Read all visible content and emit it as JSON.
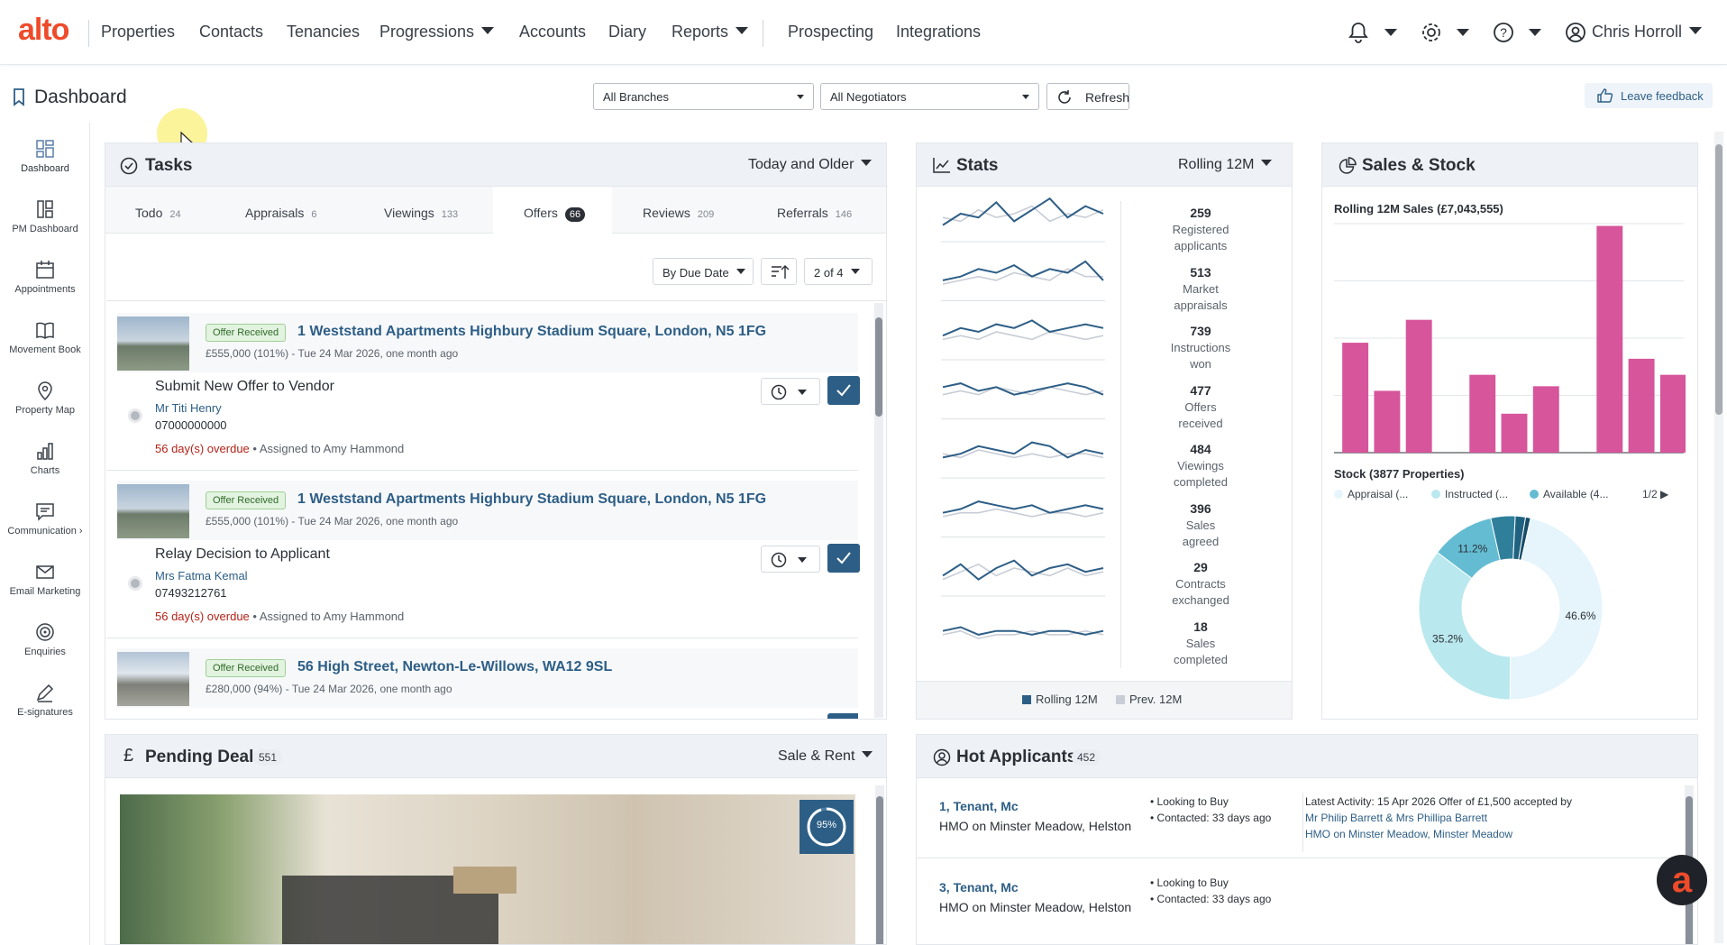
{
  "app": {
    "logo": "alto"
  },
  "nav": {
    "items": [
      "Properties",
      "Contacts",
      "Tenancies",
      "Progressions",
      "Accounts",
      "Diary",
      "Reports",
      "Prospecting",
      "Integrations"
    ],
    "user": "Chris Horroll"
  },
  "header": {
    "title": "Dashboard",
    "branches": "All Branches",
    "negotiators": "All Negotiators",
    "refresh": "Refresh",
    "feedback": "Leave feedback"
  },
  "sidebar": {
    "items": [
      "Dashboard",
      "PM Dashboard",
      "Appointments",
      "Movement Book",
      "Property Map",
      "Charts",
      "Communication",
      "Email Marketing",
      "Enquiries",
      "E-signatures"
    ]
  },
  "tasks": {
    "title": "Tasks",
    "filter": "Today and Older",
    "tabs": [
      {
        "label": "Todo",
        "count": "24"
      },
      {
        "label": "Appraisals",
        "count": "6"
      },
      {
        "label": "Viewings",
        "count": "133"
      },
      {
        "label": "Offers",
        "count": "66"
      },
      {
        "label": "Reviews",
        "count": "209"
      },
      {
        "label": "Referrals",
        "count": "146"
      }
    ],
    "sort": "By Due Date",
    "page": "2 of 4",
    "entries": [
      {
        "badge": "Offer Received",
        "address": "1 Weststand Apartments Highbury Stadium Square, London, N5 1FG",
        "price": "£555,000 (101%) - Tue 24 Mar 2026, one month ago",
        "task": "Submit New Offer to Vendor",
        "contact": "Mr Titi Henry",
        "phone": "07000000000",
        "overdue": "56 day(s) overdue",
        "assigned": "Assigned to Amy Hammond"
      },
      {
        "badge": "Offer Received",
        "address": "1 Weststand Apartments Highbury Stadium Square, London, N5 1FG",
        "price": "£555,000 (101%) - Tue 24 Mar 2026, one month ago",
        "task": "Relay Decision to Applicant",
        "contact": "Mrs Fatma Kemal",
        "phone": "07493212761",
        "overdue": "56 day(s) overdue",
        "assigned": "Assigned to Amy Hammond"
      },
      {
        "badge": "Offer Received",
        "address": "56 High Street, Newton-Le-Willows, WA12 9SL",
        "price": "£280,000 (94%) - Tue 24 Mar 2026, one month ago"
      }
    ]
  },
  "stats": {
    "title": "Stats",
    "filter": "Rolling 12M",
    "items": [
      {
        "value": "259",
        "label1": "Registered",
        "label2": "applicants"
      },
      {
        "value": "513",
        "label1": "Market",
        "label2": "appraisals"
      },
      {
        "value": "739",
        "label1": "Instructions",
        "label2": "won"
      },
      {
        "value": "477",
        "label1": "Offers",
        "label2": "received"
      },
      {
        "value": "484",
        "label1": "Viewings",
        "label2": "completed"
      },
      {
        "value": "396",
        "label1": "Sales",
        "label2": "agreed"
      },
      {
        "value": "29",
        "label1": "Contracts",
        "label2": "exchanged"
      },
      {
        "value": "18",
        "label1": "Sales",
        "label2": "completed"
      }
    ],
    "legend_current": "Rolling 12M",
    "legend_prev": "Prev. 12M",
    "color_current": "#2d5e86",
    "color_prev": "#c8cdd6"
  },
  "sales": {
    "title": "Sales & Stock",
    "sales_title": "Rolling 12M Sales (£7,043,555)",
    "stock_title": "Stock (3877 Properties)",
    "stock_legend": [
      "Appraisal (...",
      "Instructed (...",
      "Available (4..."
    ],
    "stock_page": "1/2",
    "colors": {
      "bar": "#d6559b"
    }
  },
  "pending": {
    "title": "Pending Deals",
    "count": "551",
    "filter": "Sale & Rent",
    "progress": "95%"
  },
  "hot": {
    "title": "Hot Applicants",
    "count": "452",
    "rows": [
      {
        "name": "1, Tenant, Mc",
        "property": "HMO on Minster Meadow, Helston",
        "status": "Looking to Buy",
        "contacted": "Contacted: 33 days ago",
        "activity": "Latest Activity: 15 Apr 2026 Offer of £1,500 accepted by",
        "activity_link1": "Mr Philip Barrett & Mrs Phillipa Barrett",
        "activity_link2": "HMO on Minster Meadow, Minster Meadow"
      },
      {
        "name": "3, Tenant, Mc",
        "property": "HMO on Minster Meadow, Helston",
        "status": "Looking to Buy",
        "contacted": "Contacted: 33 days ago"
      }
    ]
  },
  "chart_data": [
    {
      "type": "bar",
      "title": "Rolling 12M Sales (£7,043,555)",
      "categories": [
        "",
        "",
        "",
        "",
        "",
        "",
        "",
        "",
        "",
        "",
        ""
      ],
      "values": [
        48,
        27,
        58,
        0,
        34,
        17,
        29,
        0,
        99,
        41,
        34
      ],
      "ylim": [
        0,
        100
      ]
    },
    {
      "type": "pie",
      "title": "Stock (3877 Properties)",
      "labels": [
        "",
        "",
        "",
        "",
        "",
        ""
      ],
      "values": [
        46.6,
        35.2,
        11.2,
        4.3,
        1.8,
        0.9
      ],
      "data_labels": [
        "46.6%",
        "35.2%",
        "11.2%",
        "",
        "",
        ""
      ],
      "colors": [
        "#e6f5fb",
        "#b9e8ee",
        "#64bcd2",
        "#2f7f9b",
        "#1f6280",
        "#154b66"
      ]
    }
  ]
}
